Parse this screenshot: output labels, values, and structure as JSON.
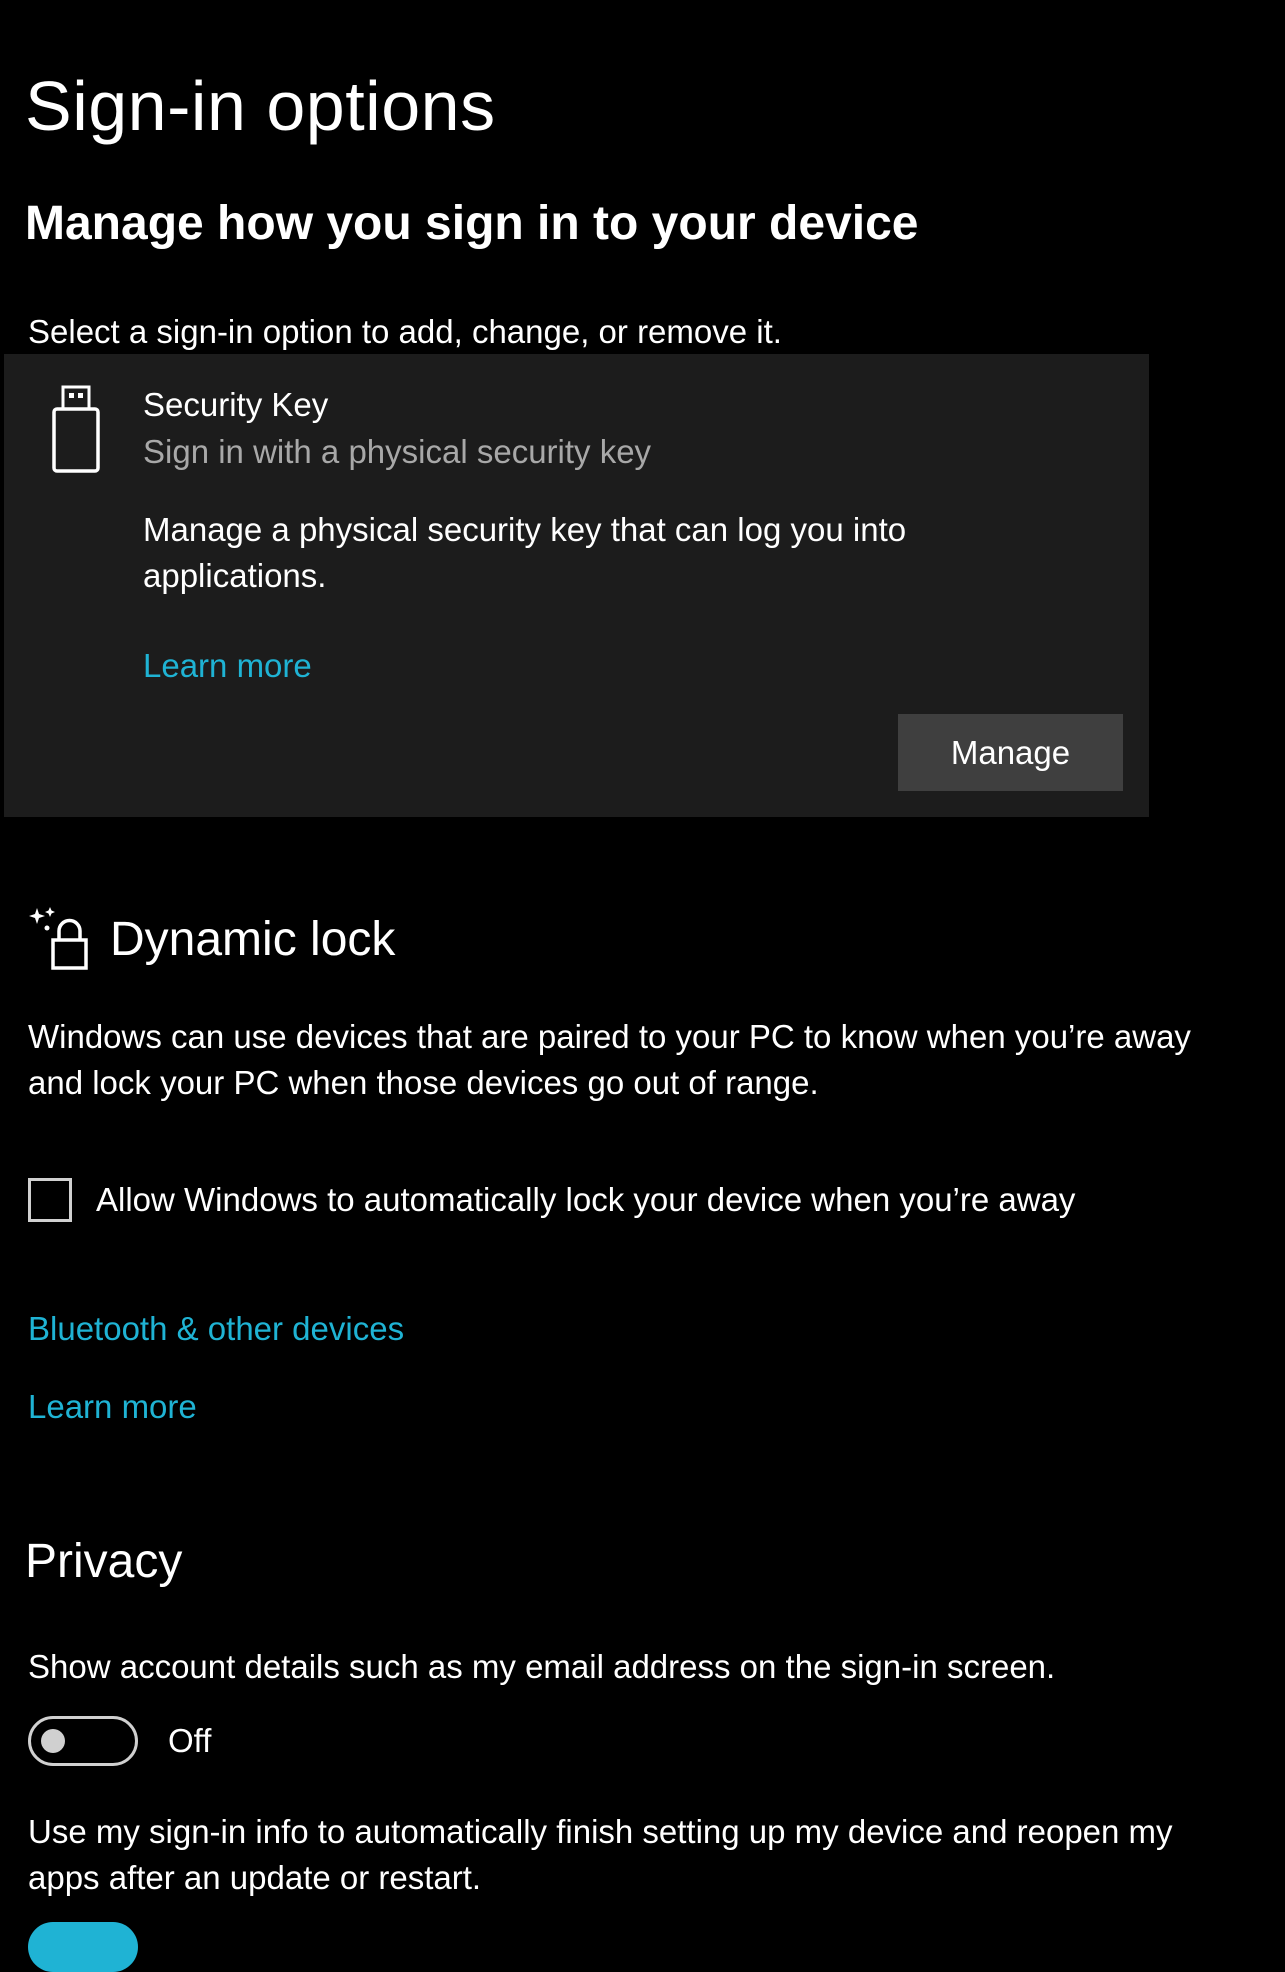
{
  "page": {
    "title": "Sign-in options",
    "subtitle": "Manage how you sign in to your device",
    "intro": "Select a sign-in option to add, change, or remove it."
  },
  "security_key": {
    "title": "Security Key",
    "subtitle": "Sign in with a physical security key",
    "description": "Manage a physical security key that can log you into applications.",
    "learn_more": "Learn more",
    "manage_button": "Manage",
    "icon": "usb-key-icon"
  },
  "dynamic_lock": {
    "title": "Dynamic lock",
    "icon": "dynamic-lock-icon",
    "description": "Windows can use devices that are paired to your PC to know when you’re away and lock your PC when those devices go out of range.",
    "checkbox_label": "Allow Windows to automatically lock your device when you’re away",
    "checkbox_checked": false,
    "bluetooth_link": "Bluetooth & other devices",
    "learn_more": "Learn more"
  },
  "privacy": {
    "title": "Privacy",
    "account_details_desc": "Show account details such as my email address on the sign-in screen.",
    "account_details_state": "Off",
    "sign_in_info_desc": "Use my sign-in info to automatically finish setting up my device and reopen my apps after an update or restart."
  },
  "colors": {
    "background": "#000000",
    "card": "#1c1c1c",
    "accent": "#1fb3d4",
    "button": "#3f3f3f",
    "secondary_text": "#a8a8a8"
  }
}
